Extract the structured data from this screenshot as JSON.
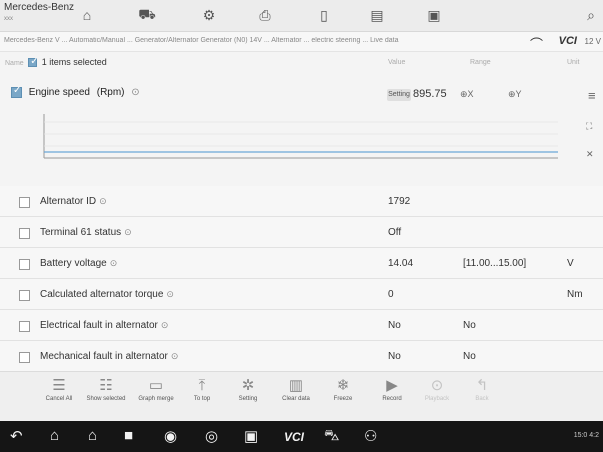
{
  "topbar": {
    "brand": "Mercedes-Benz",
    "brand_sub": "xxx",
    "icons": [
      "home-icon",
      "vehicle-icon",
      "gear-icon",
      "printer-icon",
      "document-icon",
      "save-icon",
      "chat-icon",
      "search-icon"
    ]
  },
  "subbar": {
    "breadcrumb": "Mercedes-Benz V ... Automatic/Manual ... Generator/Alternator Generator (N0) 14V ... Alternator ... electric steering ... Live data",
    "vci_label": "VCI",
    "battery": "12 V"
  },
  "list_header": {
    "name_col": "Name",
    "selected_text": "1 items selected",
    "value_col": "Value",
    "range_col": "Range",
    "unit_col": "Unit"
  },
  "engine": {
    "label": "Engine speed",
    "unit": "(Rpm)",
    "unit_button": "Setting",
    "value": "895.75",
    "zoom_x": "X",
    "zoom_y": "Y"
  },
  "rows": [
    {
      "name": "Alternator ID",
      "value": "1792",
      "range": "",
      "unit": ""
    },
    {
      "name": "Terminal 61 status",
      "value": "Off",
      "range": "",
      "unit": ""
    },
    {
      "name": "Battery voltage",
      "value": "14.04",
      "range": "[11.00...15.00]",
      "unit": "V"
    },
    {
      "name": "Calculated alternator torque",
      "value": "0",
      "range": "",
      "unit": "Nm"
    },
    {
      "name": "Electrical fault in alternator",
      "value": "No",
      "range": "No",
      "unit": ""
    },
    {
      "name": "Mechanical fault in alternator",
      "value": "No",
      "range": "No",
      "unit": ""
    }
  ],
  "toolbar": [
    {
      "label": "Cancel All",
      "icon": "list-icon"
    },
    {
      "label": "Show selected",
      "icon": "list-check-icon"
    },
    {
      "label": "Graph merge",
      "icon": "chart-icon"
    },
    {
      "label": "To top",
      "icon": "to-top-icon"
    },
    {
      "label": "Setting",
      "icon": "setting-icon"
    },
    {
      "label": "Clear data",
      "icon": "trash-icon"
    },
    {
      "label": "Freeze",
      "icon": "freeze-icon"
    },
    {
      "label": "Record",
      "icon": "record-icon"
    },
    {
      "label": "Playback",
      "icon": "play-icon"
    },
    {
      "label": "Back",
      "icon": "back-icon"
    }
  ],
  "navbar": {
    "status": "15:0 4:2"
  }
}
